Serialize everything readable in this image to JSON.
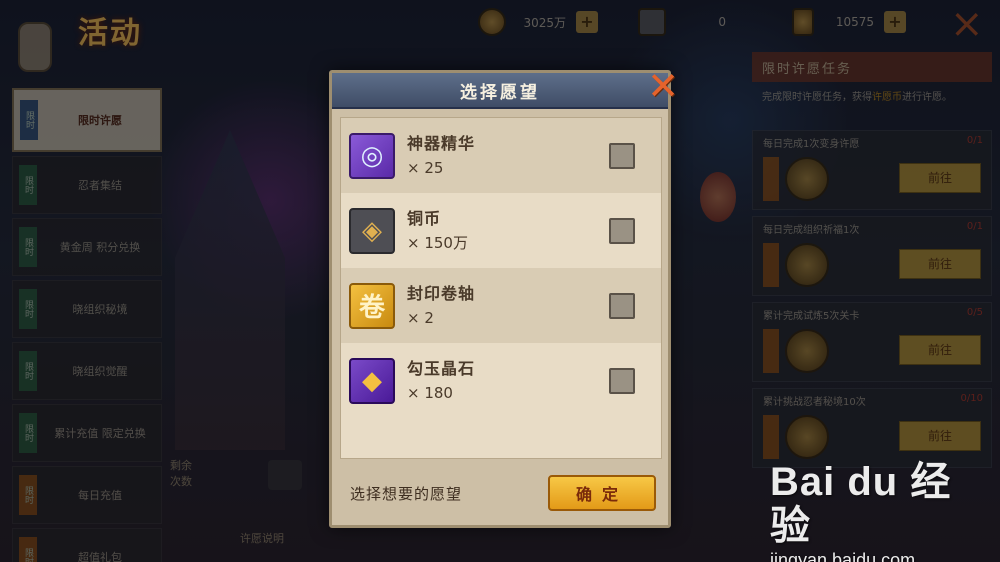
{
  "header": {
    "logo_text": "活动",
    "currencies": [
      {
        "icon": "copper-coin-icon",
        "value": "3025万",
        "add_label": "+"
      },
      {
        "icon": "key-icon",
        "value": "0",
        "add_label": "+"
      },
      {
        "icon": "gold-ingot-icon",
        "value": "10575",
        "add_label": "+"
      }
    ],
    "close_icon": "×"
  },
  "sidebar": {
    "items": [
      {
        "tag": "限时",
        "label": "限时许愿",
        "active": true
      },
      {
        "tag": "限时",
        "label": "忍者集结"
      },
      {
        "tag": "限时",
        "label": "黄金周 积分兑换"
      },
      {
        "tag": "限时",
        "label": "晓组织秘境"
      },
      {
        "tag": "限时",
        "label": "晓组织觉醒"
      },
      {
        "tag": "限时",
        "label": "累计充值 限定兑换"
      },
      {
        "tag": "限时",
        "label": "每日充值"
      },
      {
        "tag": "限时",
        "label": "超值礼包"
      }
    ]
  },
  "right_panel": {
    "title": "限时许愿任务",
    "desc_prefix": "完成限时许愿任务，获得",
    "desc_highlight": "许愿币",
    "desc_suffix": "进行许愿。",
    "tasks": [
      {
        "name": "每日完成1次变身许愿",
        "count": "0/1",
        "button": "前往"
      },
      {
        "name": "每日完成组织祈福1次",
        "count": "0/1",
        "button": "前往"
      },
      {
        "name": "累计完成试炼5次关卡",
        "count": "0/5",
        "button": "前往"
      },
      {
        "name": "累计挑战忍者秘境10次",
        "count": "0/10",
        "button": "前往"
      }
    ]
  },
  "bottom_left": {
    "label_line1": "剩余",
    "label_line2": "次数",
    "scroll_text": "许愿说明"
  },
  "modal": {
    "title": "选择愿望",
    "close_glyph": "✕",
    "items": [
      {
        "name": "神器精华",
        "qty": "× 25",
        "icon": "artifact-essence-icon",
        "glyph": "◎",
        "checked": false
      },
      {
        "name": "铜币",
        "qty": "× 150万",
        "icon": "copper-coin-icon",
        "glyph": "◈",
        "checked": false
      },
      {
        "name": "封印卷轴",
        "qty": "× 2",
        "icon": "seal-scroll-icon",
        "glyph": "卷",
        "checked": false
      },
      {
        "name": "勾玉晶石",
        "qty": "× 180",
        "icon": "magatama-crystal-icon",
        "glyph": "◆",
        "checked": false
      }
    ],
    "footer_text": "选择想要的愿望",
    "confirm_label": "确定"
  },
  "watermark": {
    "brand": "Bai du 经验",
    "url": "jingyan.baidu.com"
  },
  "colors": {
    "modal_bg": "#cdbfa6",
    "header_blue": "#4f5e78",
    "confirm_gold": "#f0b030",
    "close_orange": "#e5632c"
  }
}
